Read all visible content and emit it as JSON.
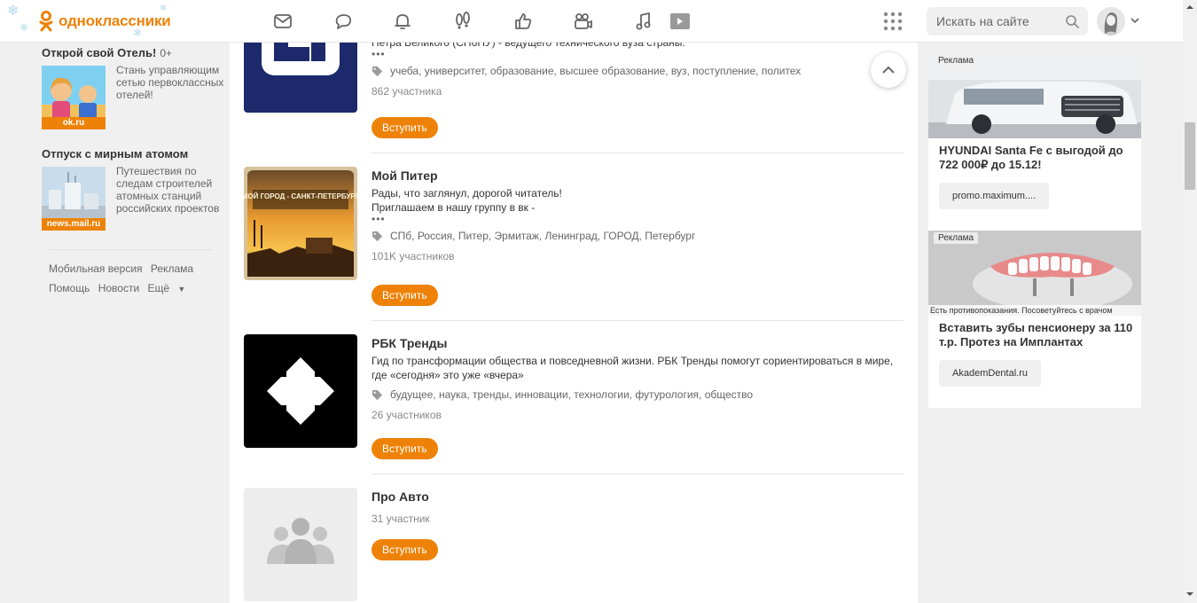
{
  "header": {
    "logo_text": "одноклассники",
    "search_placeholder": "Искать на сайте",
    "nav_icons": [
      "messages-icon",
      "discussions-icon",
      "notifications-icon",
      "guests-icon",
      "marks-icon",
      "video-icon",
      "music-icon",
      "video-play-icon"
    ]
  },
  "sidebar": {
    "promos": [
      {
        "title": "Открой свой Отель!",
        "sub": "0+",
        "source": "ok.ru",
        "desc": "Стань управляющим сетью первоклассных отелей!"
      },
      {
        "title": "Отпуск с мирным атомом",
        "source": "news.mail.ru",
        "desc": "Путешествия по следам строителей атомных станций российских проектов"
      }
    ],
    "footer_links": [
      "Мобильная версия",
      "Реклама",
      "Помощь",
      "Новости",
      "Ещё"
    ]
  },
  "groups": [
    {
      "name": "",
      "desc": "Петра Великого (СПбПУ) - ведущего технического вуза страны.",
      "tags": "учеба, университет, образование, высшее образование, вуз, поступление, политех",
      "members": "862 участника",
      "join": "Вступить"
    },
    {
      "name": "Мой Питер",
      "desc": "Рады, что заглянул, дорогой читатель!\nПриглашаем в нашу группу в вк -",
      "image_text": "МОЙ ГОРОД - САНКТ-ПЕТЕРБУРГ",
      "tags": "СПб, Россия, Питер, Эрмитаж, Ленинград, ГОРОД, Петербург",
      "members": "101K участников",
      "join": "Вступить"
    },
    {
      "name": "РБК Тренды",
      "desc": "Гид по трансформации общества и повседневной жизни. РБК Тренды помогут сориентироваться в мире, где «сегодня» это уже «вчера»",
      "tags": "будущее, наука, тренды, инновации, технологии, футурология, общество",
      "members": "26 участников",
      "join": "Вступить"
    },
    {
      "name": "Про Авто",
      "members": "31 участник",
      "join": "Вступить"
    }
  ],
  "ads": [
    {
      "label": "Реклама",
      "title": "HYUNDAI Santa Fe с выгодой до 722 000₽ до 15.12!",
      "link": "promo.maximum...."
    },
    {
      "label": "Реклама",
      "note": "Есть противопоказания. Посоветуйтесь с врачом",
      "title": "Вставить зубы пенсионеру за 110 т.р. Протез на Имплантах",
      "link": "AkademDental.ru"
    }
  ],
  "colors": {
    "accent": "#ee8208",
    "page_bg": "#f0f0f0"
  }
}
